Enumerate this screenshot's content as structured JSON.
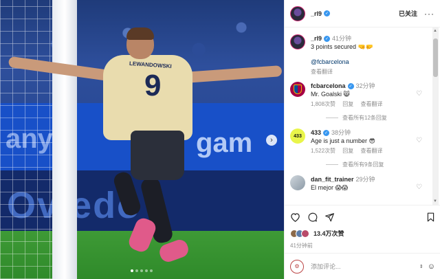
{
  "photo": {
    "jersey_name": "LEWANDOWSKI",
    "jersey_number": "9",
    "board_text_top": "gam",
    "board_text_top_left": "any",
    "board_text_bottom": "Oviedo"
  },
  "header": {
    "username": "_rl9",
    "follow_label": "已关注",
    "more_label": "···"
  },
  "caption": {
    "username": "_rl9",
    "time": "41分钟",
    "text": "3 points secured 🤜🤛",
    "mention": "@fcbarcelona",
    "translate": "查看翻译"
  },
  "comments": [
    {
      "username": "fcbarcelona",
      "time": "32分钟",
      "text": "Mr. Goalski 😸",
      "likes": "1,808次赞",
      "reply": "回复",
      "translate": "查看翻译",
      "view_replies": "查看所有12条回复"
    },
    {
      "username": "433",
      "time": "38分钟",
      "text": "Age is just a number 😎",
      "likes": "1,522次赞",
      "reply": "回复",
      "translate": "查看翻译",
      "view_replies": "查看所有9条回复"
    },
    {
      "username": "dan_fit_trainer",
      "time": "29分钟",
      "text": "El mejor 😱😱"
    }
  ],
  "actions": {
    "likes_count": "13.4万次赞",
    "post_time": "41分钟前"
  },
  "add_comment": {
    "placeholder": "添加评论..."
  },
  "colors": {
    "verified": "#3897f0",
    "text": "#262626",
    "muted": "#8e8e8e",
    "mention": "#00376b"
  }
}
